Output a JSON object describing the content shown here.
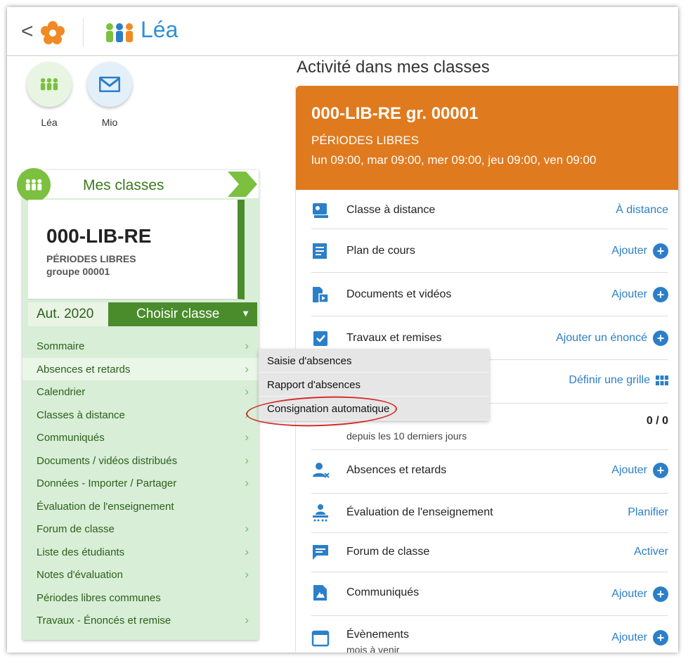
{
  "header": {
    "back_glyph": "<",
    "app_title": "Léa"
  },
  "shortcuts": [
    {
      "label": "Léa",
      "icon": "people-icon"
    },
    {
      "label": "Mio",
      "icon": "mail-icon"
    }
  ],
  "classes": {
    "title": "Mes classes",
    "code": "000-LIB-RE",
    "name": "PÉRIODES LIBRES",
    "group": "groupe 00001",
    "term": "Aut. 2020",
    "choose_label": "Choisir classe"
  },
  "menu": [
    {
      "label": "Sommaire",
      "chevron": true
    },
    {
      "label": "Absences et retards",
      "chevron": true
    },
    {
      "label": "Calendrier",
      "chevron": true
    },
    {
      "label": "Classes à distance",
      "chevron": true
    },
    {
      "label": "Communiqués",
      "chevron": true
    },
    {
      "label": "Documents / vidéos distribués",
      "chevron": true
    },
    {
      "label": "Données - Importer / Partager",
      "chevron": true
    },
    {
      "label": "Évaluation de l'enseignement",
      "chevron": false
    },
    {
      "label": "Forum de classe",
      "chevron": true
    },
    {
      "label": "Liste des étudiants",
      "chevron": true
    },
    {
      "label": "Notes d'évaluation",
      "chevron": true
    },
    {
      "label": "Périodes libres communes",
      "chevron": false
    },
    {
      "label": "Travaux - Énoncés et remise",
      "chevron": true
    }
  ],
  "submenu": [
    "Saisie d'absences",
    "Rapport d'absences",
    "Consignation automatique"
  ],
  "activity": {
    "section_title": "Activité dans mes classes",
    "class_code": "000-LIB-RE gr. 00001",
    "periods": "PÉRIODES LIBRES",
    "schedule": "lun 09:00, mar 09:00, mer 09:00, jeu 09:00, ven 09:00",
    "rows": [
      {
        "label": "Classe à distance",
        "action": "À distance"
      },
      {
        "label": "Plan de cours",
        "action": "Ajouter"
      },
      {
        "label": "Documents et vidéos",
        "action": "Ajouter"
      },
      {
        "label": "Travaux et remises",
        "action": "Ajouter un énoncé"
      },
      {
        "label": "",
        "action": "Définir une grille"
      },
      {
        "label": "",
        "sublabel": "depuis les 10 derniers jours",
        "count": "0 / 0"
      },
      {
        "label": "Absences et retards",
        "action": "Ajouter"
      },
      {
        "label": "Évaluation de l'enseignement",
        "action": "Planifier"
      },
      {
        "label": "Forum de classe",
        "action": "Activer"
      },
      {
        "label": "Communiqués",
        "action": "Ajouter"
      },
      {
        "label": "Évènements",
        "sublabel": "mois à venir",
        "action": "Ajouter"
      }
    ]
  },
  "colors": {
    "orange": "#e07a1e",
    "blue": "#2b7fc8",
    "green_dark": "#4a8c2c",
    "green_light": "#d8eed7",
    "annotation_red": "#d52b2b"
  }
}
